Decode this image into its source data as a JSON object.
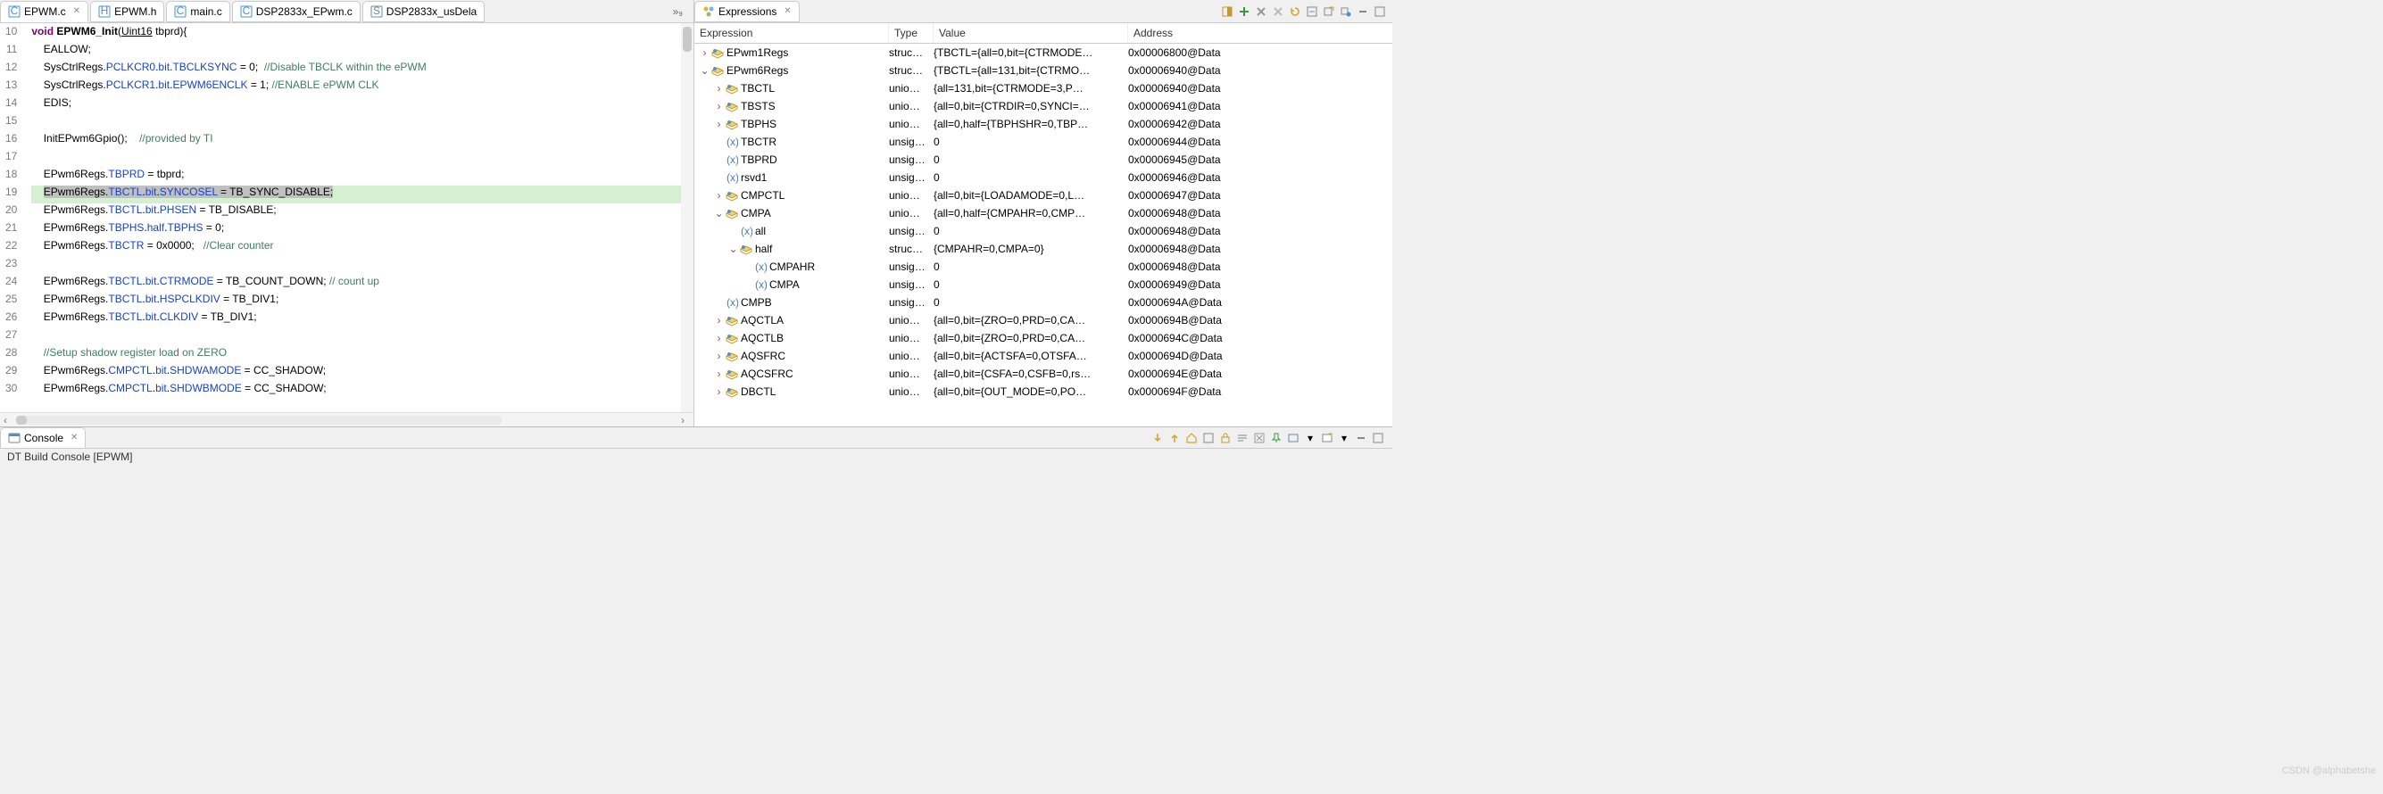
{
  "editor": {
    "tabs": [
      {
        "label": "EPWM.c",
        "kind": "c",
        "active": true,
        "close": true
      },
      {
        "label": "EPWM.h",
        "kind": "h",
        "active": false,
        "close": false
      },
      {
        "label": "main.c",
        "kind": "c",
        "active": false,
        "close": false
      },
      {
        "label": "DSP2833x_EPwm.c",
        "kind": "c",
        "active": false,
        "close": false
      },
      {
        "label": "DSP2833x_usDela",
        "kind": "s",
        "active": false,
        "close": false
      }
    ],
    "more_count_glyph": "»₉",
    "lines": [
      {
        "n": 10,
        "html": "<span class='kw'>void</span> <b>EPWM6_Init</b>(<u>Uint16</u> tbprd){"
      },
      {
        "n": 11,
        "html": "    EALLOW;"
      },
      {
        "n": 12,
        "html": "    SysCtrlRegs.<span class='field'>PCLKCR0</span>.<span class='field'>bit</span>.<span class='field'>TBCLKSYNC</span> = 0;  <span class='cmt'>//Disable TBCLK within the ePWM</span>"
      },
      {
        "n": 13,
        "html": "    SysCtrlRegs.<span class='field'>PCLKCR1</span>.<span class='field'>bit</span>.<span class='field'>EPWM6ENCLK</span> = 1; <span class='cmt'>//ENABLE ePWM CLK</span>"
      },
      {
        "n": 14,
        "html": "    EDIS;"
      },
      {
        "n": 15,
        "html": ""
      },
      {
        "n": 16,
        "html": "    InitEPwm6Gpio();    <span class='cmt'>//provided by TI</span>"
      },
      {
        "n": 17,
        "html": ""
      },
      {
        "n": 18,
        "html": "    EPwm6Regs.<span class='field'>TBPRD</span> = tbprd;"
      },
      {
        "n": 19,
        "hl": true,
        "html": "    <span class='sel'>EPwm6Regs.<span class='field'>TBCTL</span>.<span class='field'>bit</span>.<span class='field'>SYNCOSEL</span> = TB_SYNC_DISABLE;</span>"
      },
      {
        "n": 20,
        "html": "    EPwm6Regs.<span class='field'>TBCTL</span>.<span class='field'>bit</span>.<span class='field'>PHSEN</span> = TB_DISABLE;"
      },
      {
        "n": 21,
        "html": "    EPwm6Regs.<span class='field'>TBPHS</span>.<span class='field'>half</span>.<span class='field'>TBPHS</span> = 0;"
      },
      {
        "n": 22,
        "html": "    EPwm6Regs.<span class='field'>TBCTR</span> = 0x0000;   <span class='cmt'>//Clear counter</span>"
      },
      {
        "n": 23,
        "html": ""
      },
      {
        "n": 24,
        "html": "    EPwm6Regs.<span class='field'>TBCTL</span>.<span class='field'>bit</span>.<span class='field'>CTRMODE</span> = TB_COUNT_DOWN; <span class='cmt'>// count up</span>"
      },
      {
        "n": 25,
        "html": "    EPwm6Regs.<span class='field'>TBCTL</span>.<span class='field'>bit</span>.<span class='field'>HSPCLKDIV</span> = TB_DIV1;"
      },
      {
        "n": 26,
        "html": "    EPwm6Regs.<span class='field'>TBCTL</span>.<span class='field'>bit</span>.<span class='field'>CLKDIV</span> = TB_DIV1;"
      },
      {
        "n": 27,
        "html": ""
      },
      {
        "n": 28,
        "html": "    <span class='cmt'>//Setup shadow register load on ZERO</span>"
      },
      {
        "n": 29,
        "html": "    EPwm6Regs.<span class='field'>CMPCTL</span>.<span class='field'>bit</span>.<span class='field'>SHDWAMODE</span> = CC_SHADOW;"
      },
      {
        "n": 30,
        "html": "    EPwm6Regs.<span class='field'>CMPCTL</span>.<span class='field'>bit</span>.<span class='field'>SHDWBMODE</span> = CC_SHADOW;"
      }
    ]
  },
  "expressions": {
    "tab_label": "Expressions",
    "columns": {
      "expr": "Expression",
      "type": "Type",
      "value": "Value",
      "addr": "Address"
    },
    "rows": [
      {
        "indent": 0,
        "twisty": ">",
        "icon": "struct",
        "name": "EPwm1Regs",
        "type": "struc…",
        "value": "{TBCTL={all=0,bit={CTRMODE…",
        "addr": "0x00006800@Data"
      },
      {
        "indent": 0,
        "twisty": "v",
        "icon": "struct",
        "name": "EPwm6Regs",
        "type": "struc…",
        "value": "{TBCTL={all=131,bit={CTRMO…",
        "addr": "0x00006940@Data"
      },
      {
        "indent": 1,
        "twisty": ">",
        "icon": "union",
        "name": "TBCTL",
        "type": "unio…",
        "value": "{all=131,bit={CTRMODE=3,P…",
        "addr": "0x00006940@Data"
      },
      {
        "indent": 1,
        "twisty": ">",
        "icon": "union",
        "name": "TBSTS",
        "type": "unio…",
        "value": "{all=0,bit={CTRDIR=0,SYNCI=…",
        "addr": "0x00006941@Data"
      },
      {
        "indent": 1,
        "twisty": ">",
        "icon": "union",
        "name": "TBPHS",
        "type": "unio…",
        "value": "{all=0,half={TBPHSHR=0,TBP…",
        "addr": "0x00006942@Data"
      },
      {
        "indent": 1,
        "twisty": "",
        "icon": "var",
        "name": "TBCTR",
        "type": "unsig…",
        "value": "0",
        "addr": "0x00006944@Data"
      },
      {
        "indent": 1,
        "twisty": "",
        "icon": "var",
        "name": "TBPRD",
        "type": "unsig…",
        "value": "0",
        "addr": "0x00006945@Data"
      },
      {
        "indent": 1,
        "twisty": "",
        "icon": "var",
        "name": "rsvd1",
        "type": "unsig…",
        "value": "0",
        "addr": "0x00006946@Data"
      },
      {
        "indent": 1,
        "twisty": ">",
        "icon": "union",
        "name": "CMPCTL",
        "type": "unio…",
        "value": "{all=0,bit={LOADAMODE=0,L…",
        "addr": "0x00006947@Data"
      },
      {
        "indent": 1,
        "twisty": "v",
        "icon": "union",
        "name": "CMPA",
        "type": "unio…",
        "value": "{all=0,half={CMPAHR=0,CMP…",
        "addr": "0x00006948@Data"
      },
      {
        "indent": 2,
        "twisty": "",
        "icon": "var",
        "name": "all",
        "type": "unsig…",
        "value": "0",
        "addr": "0x00006948@Data"
      },
      {
        "indent": 2,
        "twisty": "v",
        "icon": "struct",
        "name": "half",
        "type": "struc…",
        "value": "{CMPAHR=0,CMPA=0}",
        "addr": "0x00006948@Data"
      },
      {
        "indent": 3,
        "twisty": "",
        "icon": "var",
        "name": "CMPAHR",
        "type": "unsig…",
        "value": "0",
        "addr": "0x00006948@Data"
      },
      {
        "indent": 3,
        "twisty": "",
        "icon": "var",
        "name": "CMPA",
        "type": "unsig…",
        "value": "0",
        "addr": "0x00006949@Data"
      },
      {
        "indent": 1,
        "twisty": "",
        "icon": "var",
        "name": "CMPB",
        "type": "unsig…",
        "value": "0",
        "addr": "0x0000694A@Data"
      },
      {
        "indent": 1,
        "twisty": ">",
        "icon": "union",
        "name": "AQCTLA",
        "type": "unio…",
        "value": "{all=0,bit={ZRO=0,PRD=0,CA…",
        "addr": "0x0000694B@Data"
      },
      {
        "indent": 1,
        "twisty": ">",
        "icon": "union",
        "name": "AQCTLB",
        "type": "unio…",
        "value": "{all=0,bit={ZRO=0,PRD=0,CA…",
        "addr": "0x0000694C@Data"
      },
      {
        "indent": 1,
        "twisty": ">",
        "icon": "union",
        "name": "AQSFRC",
        "type": "unio…",
        "value": "{all=0,bit={ACTSFA=0,OTSFA…",
        "addr": "0x0000694D@Data"
      },
      {
        "indent": 1,
        "twisty": ">",
        "icon": "union",
        "name": "AQCSFRC",
        "type": "unio…",
        "value": "{all=0,bit={CSFA=0,CSFB=0,rs…",
        "addr": "0x0000694E@Data"
      },
      {
        "indent": 1,
        "twisty": ">",
        "icon": "union",
        "name": "DBCTL",
        "type": "unio…",
        "value": "{all=0,bit={OUT_MODE=0,PO…",
        "addr": "0x0000694F@Data"
      }
    ]
  },
  "console": {
    "tab_label": "Console",
    "title": "DT Build Console [EPWM]"
  },
  "watermark": "CSDN @alphabetshe"
}
